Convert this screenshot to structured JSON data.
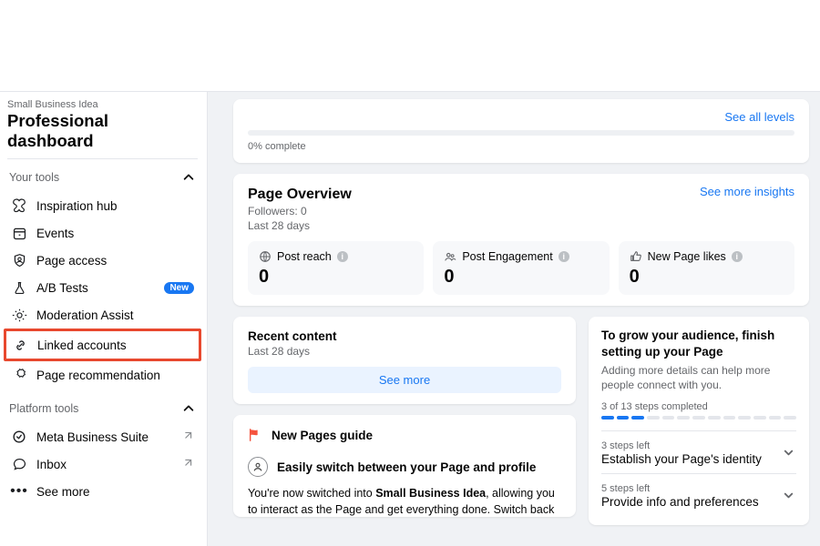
{
  "sidebar": {
    "crumb": "Small Business Idea",
    "title": "Professional dashboard",
    "your_tools_label": "Your tools",
    "platform_tools_label": "Platform tools",
    "items": [
      {
        "label": "Inspiration hub"
      },
      {
        "label": "Events"
      },
      {
        "label": "Page access"
      },
      {
        "label": "A/B Tests",
        "badge": "New"
      },
      {
        "label": "Moderation Assist"
      },
      {
        "label": "Linked accounts"
      },
      {
        "label": "Page recommendation"
      }
    ],
    "platform_items": [
      {
        "label": "Meta Business Suite"
      },
      {
        "label": "Inbox"
      },
      {
        "label": "See more"
      }
    ]
  },
  "levels": {
    "link": "See all levels",
    "complete_label": "0% complete"
  },
  "overview": {
    "title": "Page Overview",
    "followers": "Followers: 0",
    "period": "Last 28 days",
    "insights_link": "See more insights",
    "metrics": [
      {
        "label": "Post reach",
        "value": "0"
      },
      {
        "label": "Post Engagement",
        "value": "0"
      },
      {
        "label": "New Page likes",
        "value": "0"
      }
    ]
  },
  "recent": {
    "title": "Recent content",
    "period": "Last 28 days",
    "see_more": "See more"
  },
  "guide": {
    "title": "New Pages guide",
    "switch_heading": "Easily switch between your Page and profile",
    "body_prefix": "You're now switched into ",
    "body_bold": "Small Business Idea",
    "body_suffix": ", allowing you to interact as the Page and get everything done. Switch back into your profile at any time"
  },
  "setup": {
    "title": "To grow your audience, finish setting up your Page",
    "subtitle": "Adding more details can help more people connect with you.",
    "progress_label": "3 of 13 steps completed",
    "done": 3,
    "total": 13,
    "items": [
      {
        "left": "3 steps left",
        "title": "Establish your Page's identity"
      },
      {
        "left": "5 steps left",
        "title": "Provide info and preferences"
      }
    ]
  }
}
